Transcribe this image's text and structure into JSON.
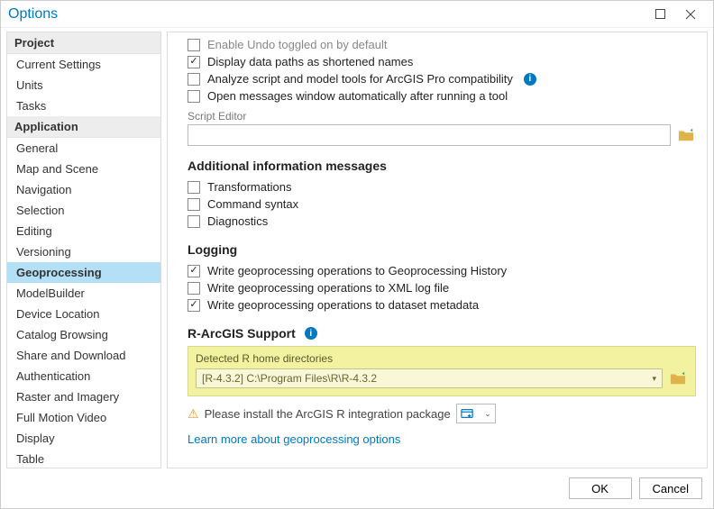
{
  "window": {
    "title": "Options"
  },
  "sidebar": {
    "groups": [
      {
        "label": "Project",
        "items": [
          "Current Settings",
          "Units",
          "Tasks"
        ]
      },
      {
        "label": "Application",
        "items": [
          "General",
          "Map and Scene",
          "Navigation",
          "Selection",
          "Editing",
          "Versioning",
          "Geoprocessing",
          "ModelBuilder",
          "Device Location",
          "Catalog Browsing",
          "Share and Download",
          "Authentication",
          "Raster and Imagery",
          "Full Motion Video",
          "Display",
          "Table"
        ]
      }
    ],
    "selected": "Geoprocessing"
  },
  "content": {
    "topChecks": [
      {
        "label": "Enable Undo toggled on by default",
        "checked": false,
        "cut": true
      },
      {
        "label": "Display data paths as shortened names",
        "checked": true
      },
      {
        "label": "Analyze script and model tools for ArcGIS Pro compatibility",
        "checked": false,
        "info": true
      },
      {
        "label": "Open messages window automatically after running a tool",
        "checked": false
      }
    ],
    "scriptEditor": {
      "label": "Script Editor",
      "value": ""
    },
    "section_additional": "Additional information messages",
    "additionalChecks": [
      {
        "label": "Transformations",
        "checked": false
      },
      {
        "label": "Command syntax",
        "checked": false
      },
      {
        "label": "Diagnostics",
        "checked": false
      }
    ],
    "section_logging": "Logging",
    "loggingChecks": [
      {
        "label": "Write geoprocessing operations to Geoprocessing History",
        "checked": true
      },
      {
        "label": "Write geoprocessing operations to XML log file",
        "checked": false
      },
      {
        "label": "Write geoprocessing operations to dataset metadata",
        "checked": true
      }
    ],
    "section_r": "R-ArcGIS Support",
    "r": {
      "detectedLabel": "Detected R home directories",
      "selected": "[R-4.3.2] C:\\Program Files\\R\\R-4.3.2"
    },
    "warn": "Please install the ArcGIS R integration package",
    "learnMore": "Learn more about geoprocessing options"
  },
  "footer": {
    "ok": "OK",
    "cancel": "Cancel"
  }
}
